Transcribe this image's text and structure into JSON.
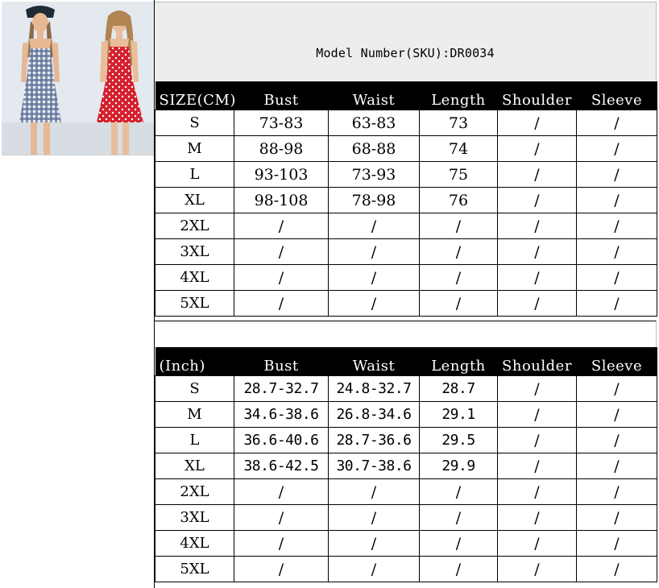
{
  "header": {
    "sku_text": "Model Number(SKU):DR0034"
  },
  "colors": {
    "header_bg": "#000000",
    "header_text": "#ffffff",
    "sku_bg": "#ededed",
    "dress_left": "#3b4f78",
    "dress_right": "#d4212e"
  },
  "table_cm": {
    "headers": [
      "SIZE(CM)",
      "Bust",
      "Waist",
      "Length",
      "Shoulder",
      "Sleeve"
    ],
    "rows": [
      [
        "S",
        "73-83",
        "63-83",
        "73",
        "/",
        "/"
      ],
      [
        "M",
        "88-98",
        "68-88",
        "74",
        "/",
        "/"
      ],
      [
        "L",
        "93-103",
        "73-93",
        "75",
        "/",
        "/"
      ],
      [
        "XL",
        "98-108",
        "78-98",
        "76",
        "/",
        "/"
      ],
      [
        "2XL",
        "/",
        "/",
        "/",
        "/",
        "/"
      ],
      [
        "3XL",
        "/",
        "/",
        "/",
        "/",
        "/"
      ],
      [
        "4XL",
        "/",
        "/",
        "/",
        "/",
        "/"
      ],
      [
        "5XL",
        "/",
        "/",
        "/",
        "/",
        "/"
      ]
    ]
  },
  "table_inch": {
    "headers": [
      "(Inch)",
      "Bust",
      "Waist",
      "Length",
      "Shoulder",
      "Sleeve"
    ],
    "rows": [
      [
        "S",
        "28.7-32.7",
        "24.8-32.7",
        "28.7",
        "/",
        "/"
      ],
      [
        "M",
        "34.6-38.6",
        "26.8-34.6",
        "29.1",
        "/",
        "/"
      ],
      [
        "L",
        "36.6-40.6",
        "28.7-36.6",
        "29.5",
        "/",
        "/"
      ],
      [
        "XL",
        "38.6-42.5",
        "30.7-38.6",
        "29.9",
        "/",
        "/"
      ],
      [
        "2XL",
        "/",
        "/",
        "/",
        "/",
        "/"
      ],
      [
        "3XL",
        "/",
        "/",
        "/",
        "/",
        "/"
      ],
      [
        "4XL",
        "/",
        "/",
        "/",
        "/",
        "/"
      ],
      [
        "5XL",
        "/",
        "/",
        "/",
        "/",
        "/"
      ]
    ]
  }
}
